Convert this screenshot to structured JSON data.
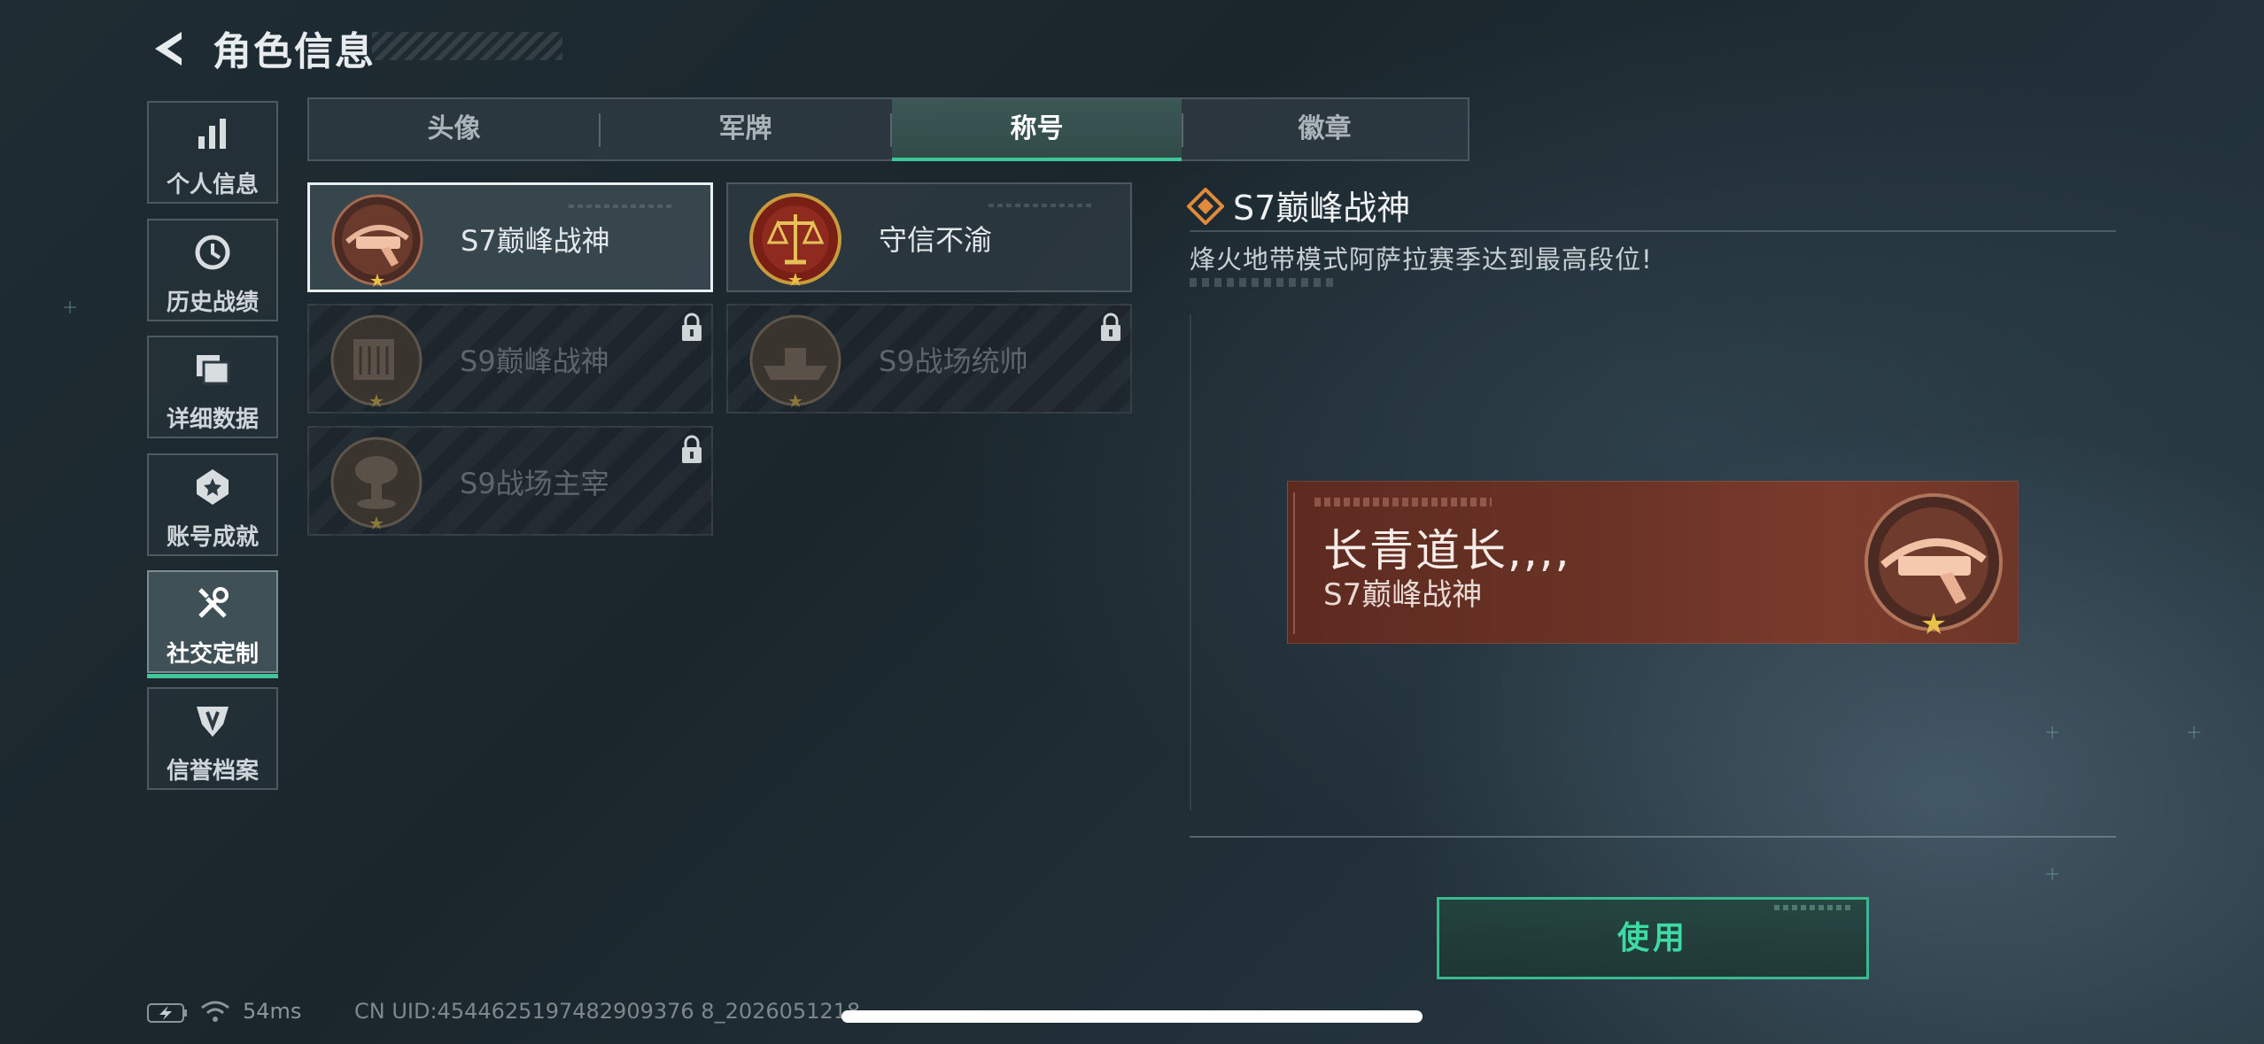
{
  "header": {
    "title": "角色信息"
  },
  "sidebar": {
    "items": [
      {
        "label": "个人信息",
        "icon": "bar-chart-icon"
      },
      {
        "label": "历史战绩",
        "icon": "clock-history-icon"
      },
      {
        "label": "详细数据",
        "icon": "folder-data-icon"
      },
      {
        "label": "账号成就",
        "icon": "achievement-medal-icon"
      },
      {
        "label": "社交定制",
        "icon": "tools-wrench-icon",
        "active": true
      },
      {
        "label": "信誉档案",
        "icon": "credit-shield-icon"
      }
    ]
  },
  "tabs": [
    {
      "label": "头像"
    },
    {
      "label": "军牌"
    },
    {
      "label": "称号",
      "active": true
    },
    {
      "label": "徽章"
    }
  ],
  "titles": [
    {
      "name": "S7巅峰战神",
      "locked": false,
      "selected": true
    },
    {
      "name": "守信不渝",
      "locked": false,
      "selected": false
    },
    {
      "name": "S9巅峰战神",
      "locked": true,
      "selected": false
    },
    {
      "name": "S9战场统帅",
      "locked": true,
      "selected": false
    },
    {
      "name": "S9战场主宰",
      "locked": true,
      "selected": false
    }
  ],
  "detail": {
    "title": "S7巅峰战神",
    "description": "烽火地带模式阿萨拉赛季达到最高段位!",
    "preview": {
      "player_name": "长青道长,,,,",
      "title": "S7巅峰战神"
    },
    "use_button": "使用"
  },
  "status": {
    "ping": "54ms",
    "uid": "CN UID:4544625197482909376 8_2026051218"
  },
  "colors": {
    "accent": "#3fc79a",
    "preview_bg": "#6a3326",
    "locked_text": "#5d666b"
  }
}
